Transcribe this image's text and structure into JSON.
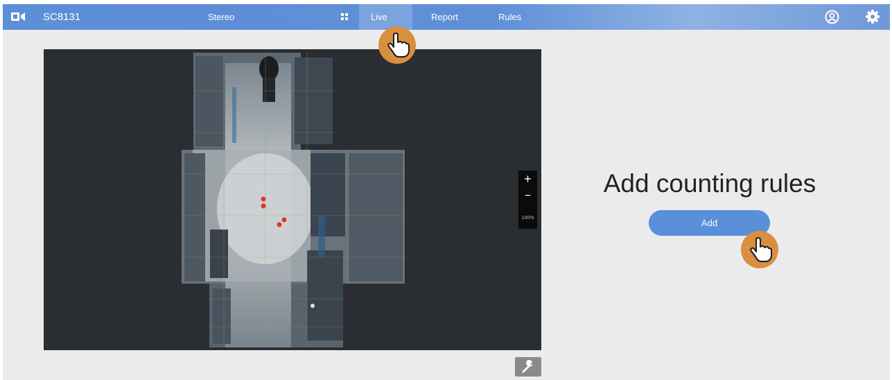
{
  "topbar": {
    "device_name": "SC8131",
    "nav": [
      {
        "label": "Stereo",
        "icon": "grid-icon"
      },
      {
        "label": "Live",
        "active": true
      },
      {
        "label": "Report"
      },
      {
        "label": "Rules"
      }
    ],
    "icons": [
      "logo-icon",
      "user-icon",
      "gear-icon"
    ]
  },
  "video": {
    "zoom": {
      "in_label": "+",
      "out_label": "−",
      "level": "100%"
    },
    "tool_icon": "wrench-icon"
  },
  "main": {
    "heading": "Add counting rules",
    "add_button_label": "Add"
  },
  "colors": {
    "topbar": "#5d8ed8",
    "accent": "#5a8fd9",
    "cursor": "#d98f3f",
    "background": "#ebebeb",
    "video_bg": "#2a2d31"
  }
}
